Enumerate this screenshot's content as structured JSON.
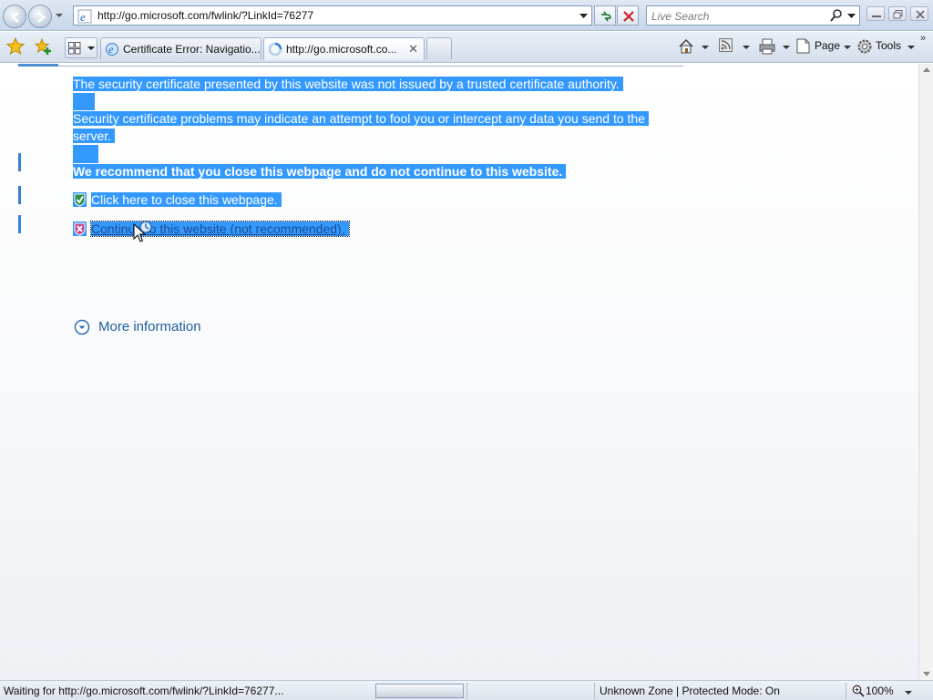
{
  "browser": {
    "address_url": "http://go.microsoft.com/fwlink/?LinkId=76277",
    "search_placeholder": "Live Search",
    "tabs": [
      {
        "label": "Certificate Error: Navigatio...",
        "active": false
      },
      {
        "label": "http://go.microsoft.co...",
        "active": true
      }
    ],
    "commands": {
      "page_label": "Page",
      "tools_label": "Tools"
    }
  },
  "page": {
    "para1": "The security certificate presented by this website was not issued by a trusted certificate authority.",
    "para2_line1": "Security certificate problems may indicate an attempt to fool you or intercept any data you send to the",
    "para2_line2": "server.",
    "recommend": "We recommend that you close this webpage and do not continue to this website.",
    "close_link": "Click here to close this webpage.",
    "continue_link": "Continue to this website (not recommended).",
    "more_info": "More information"
  },
  "status_bar": {
    "status_text": "Waiting for http://go.microsoft.com/fwlink/?LinkId=76277...",
    "zone_text": "Unknown Zone | Protected Mode: On",
    "zoom": "100%"
  },
  "colors": {
    "selection": "#3399ff",
    "link": "#1f5f9c",
    "chrome": "#d4dfec"
  }
}
